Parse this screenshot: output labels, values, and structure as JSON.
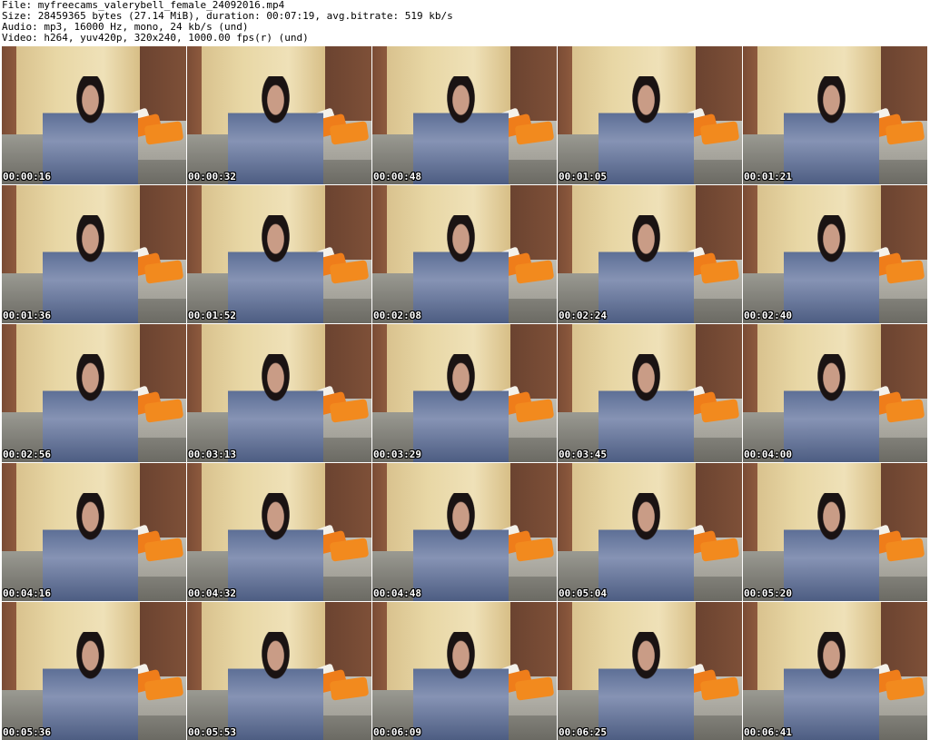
{
  "header": {
    "file_line": "File: myfreecams_valerybell_female_24092016.mp4",
    "size_line": "Size: 28459365 bytes (27.14 MiB), duration: 00:07:19, avg.bitrate: 519 kb/s",
    "audio_line": "Audio: mp3, 16000 Hz, mono, 24 kb/s (und)",
    "video_line": "Video: h264, yuv420p, 320x240, 1000.00 fps(r) (und)"
  },
  "thumbnails": [
    {
      "timestamp": "00:00:16"
    },
    {
      "timestamp": "00:00:32"
    },
    {
      "timestamp": "00:00:48"
    },
    {
      "timestamp": "00:01:05"
    },
    {
      "timestamp": "00:01:21"
    },
    {
      "timestamp": "00:01:36"
    },
    {
      "timestamp": "00:01:52"
    },
    {
      "timestamp": "00:02:08"
    },
    {
      "timestamp": "00:02:24"
    },
    {
      "timestamp": "00:02:40"
    },
    {
      "timestamp": "00:02:56"
    },
    {
      "timestamp": "00:03:13"
    },
    {
      "timestamp": "00:03:29"
    },
    {
      "timestamp": "00:03:45"
    },
    {
      "timestamp": "00:04:00"
    },
    {
      "timestamp": "00:04:16"
    },
    {
      "timestamp": "00:04:32"
    },
    {
      "timestamp": "00:04:48"
    },
    {
      "timestamp": "00:05:04"
    },
    {
      "timestamp": "00:05:20"
    },
    {
      "timestamp": "00:05:36"
    },
    {
      "timestamp": "00:05:53"
    },
    {
      "timestamp": "00:06:09"
    },
    {
      "timestamp": "00:06:25"
    },
    {
      "timestamp": "00:06:41"
    }
  ]
}
